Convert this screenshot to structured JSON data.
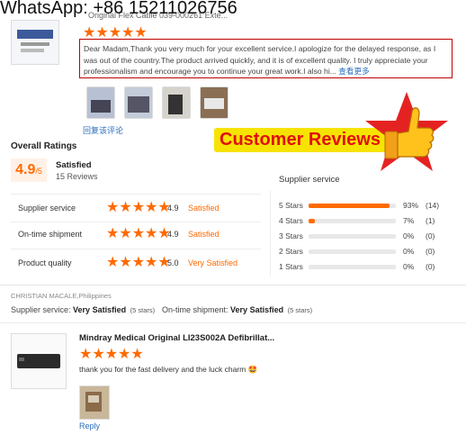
{
  "watermark": "WhatsApp: +86 15211026756",
  "product_title": "Original Flex Cable 039-000261 Exte...",
  "review": {
    "text": "Dear Madam,Thank you very much for your excellent service.I apologize for the delayed response, as I was out of the country.The product arrived quickly, and it is of excellent quality. I truly appreciate your professionalism and encourage you to continue your great work.I also hi...",
    "more_link": "查看更多",
    "reply_link": "回复该评论"
  },
  "badge_text": "Customer Reviews",
  "overall": {
    "heading": "Overall Ratings",
    "score": "4.9",
    "score_denominator": "/5",
    "status": "Satisfied",
    "count": "15 Reviews"
  },
  "metrics": [
    {
      "label": "Supplier service",
      "value": "4.9",
      "status": "Satisfied"
    },
    {
      "label": "On-time shipment",
      "value": "4.9",
      "status": "Satisfied"
    },
    {
      "label": "Product quality",
      "value": "5.0",
      "status": "Very Satisfied"
    }
  ],
  "distribution": {
    "title": "Supplier service",
    "rows": [
      {
        "label": "5 Stars",
        "percent_text": "93%",
        "count": "(14)",
        "fraction": 0.93
      },
      {
        "label": "4 Stars",
        "percent_text": "7%",
        "count": "(1)",
        "fraction": 0.07
      },
      {
        "label": "3 Stars",
        "percent_text": "0%",
        "count": "(0)",
        "fraction": 0
      },
      {
        "label": "2 Stars",
        "percent_text": "0%",
        "count": "(0)",
        "fraction": 0
      },
      {
        "label": "1 Stars",
        "percent_text": "0%",
        "count": "(0)",
        "fraction": 0
      }
    ]
  },
  "reviewer": {
    "name": "CHRISTIAN MACALE,Philippines",
    "supplier_label": "Supplier service:",
    "supplier_value": "Very Satisfied",
    "supplier_stars": "(5 stars)",
    "shipment_label": "On-time shipment:",
    "shipment_value": "Very Satisfied",
    "shipment_stars": "(5 stars)"
  },
  "second_review": {
    "product_title": "Mindray Medical Original LI23S002A Defibrillat...",
    "text": "thank you for the fast delivery and the luck charm 🤩",
    "reply": "Reply"
  },
  "colors": {
    "accent": "#ff6a00",
    "link": "#2a6ebb",
    "review_border": "#c00000",
    "badge_text": "#e01010"
  }
}
